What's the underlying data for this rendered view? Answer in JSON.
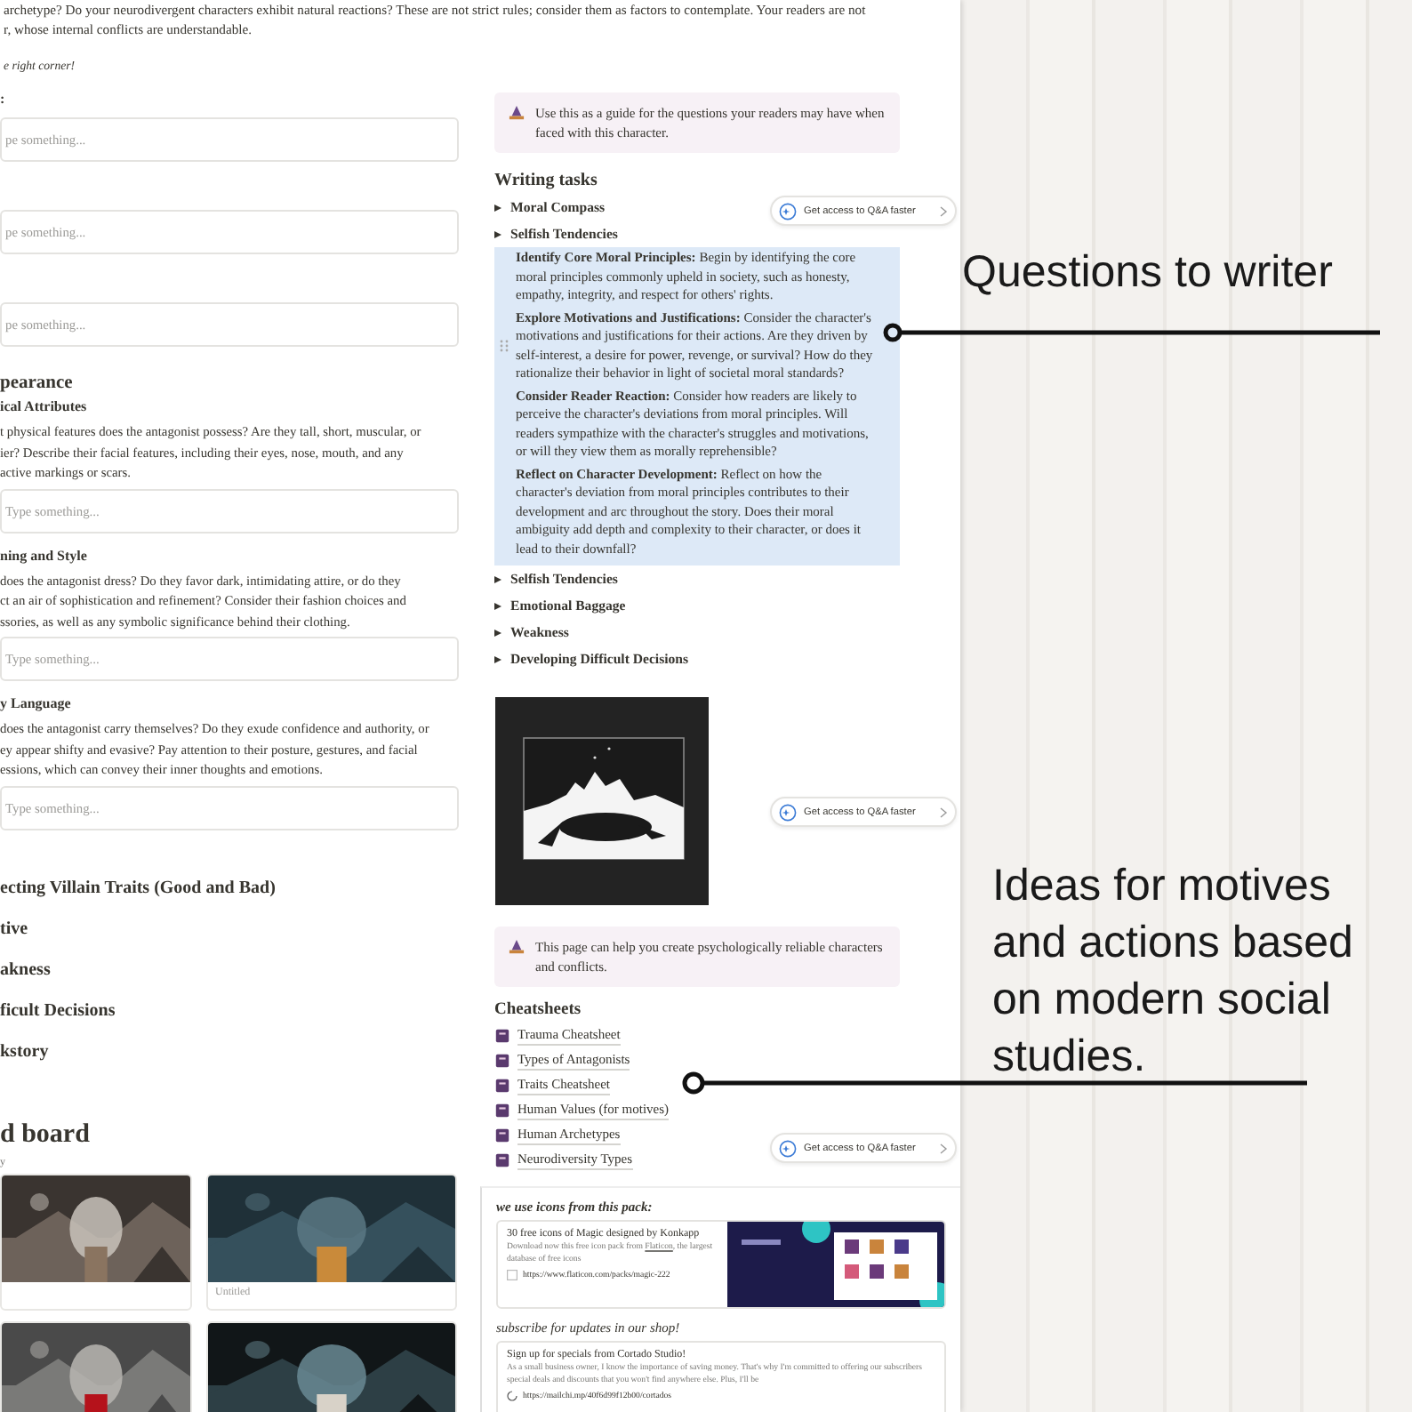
{
  "top_text": {
    "lines": [
      "archetype? Do your neurodivergent characters exhibit natural reactions? These are not strict rules; consider them as factors to contemplate. Your readers are not",
      "r, whose internal conflicts are understandable."
    ],
    "note": "e right corner!"
  },
  "left": {
    "blocks": [
      {
        "kind": "label",
        "text": ":"
      },
      {
        "kind": "field",
        "placeholder": "pe something..."
      },
      {
        "kind": "field",
        "placeholder": "pe something..."
      },
      {
        "kind": "field",
        "placeholder": "pe something..."
      },
      {
        "kind": "heading",
        "text": "pearance"
      },
      {
        "kind": "subheading",
        "text": "ical Attributes"
      },
      {
        "kind": "paragraph",
        "lines": [
          "t physical features does the antagonist possess? Are they tall, short, muscular, or",
          "ier? Describe their facial features, including their eyes, nose, mouth, and any",
          "active markings or scars."
        ]
      },
      {
        "kind": "field",
        "placeholder": "Type something..."
      },
      {
        "kind": "subheading",
        "text": "ning and Style"
      },
      {
        "kind": "paragraph",
        "lines": [
          "does the antagonist dress? Do they favor dark, intimidating attire, or do they",
          "ct an air of sophistication and refinement? Consider their fashion choices and",
          "ssories, as well as any symbolic significance behind their clothing."
        ]
      },
      {
        "kind": "field",
        "placeholder": "Type something..."
      },
      {
        "kind": "subheading",
        "text": "y Language"
      },
      {
        "kind": "paragraph",
        "lines": [
          "does the antagonist carry themselves? Do they exude confidence and authority, or",
          "ey appear shifty and evasive? Pay attention to their posture, gestures, and facial",
          "essions, which can convey their inner thoughts and emotions."
        ]
      },
      {
        "kind": "field",
        "placeholder": "Type something..."
      }
    ],
    "sections": [
      "ecting Villain Traits (Good and Bad)",
      "tive",
      "akness",
      "ficult Decisions",
      "kstory"
    ],
    "board": {
      "title": "d board",
      "subtitle": "y",
      "cards": [
        {
          "kind": "picture"
        },
        {
          "kind": "picture",
          "caption": "Untitled"
        },
        {
          "kind": "picture"
        },
        {
          "kind": "picture"
        }
      ]
    }
  },
  "right": {
    "callout": "Use this as a guide for the questions your readers may have when faced with this character.",
    "writing_tasks": {
      "title": "Writing tasks",
      "toggles_before": [
        "Moral Compass",
        "Selfish Tendencies"
      ],
      "expanded": [
        "**Identify Core Moral Principles:** Begin by identifying the core moral principles commonly upheld in society, such as honesty, empathy, integrity, and respect for others' rights.",
        "**Explore Motivations and Justifications:** Consider the character's motivations and justifications for their actions. Are they driven by self-interest, a desire for power, revenge, or survival? How do they rationalize their behavior in light of societal moral standards?",
        "**Consider Reader Reaction:** Consider how readers are likely to perceive the character's deviations from moral principles. Will readers sympathize with the character's struggles and motivations, or will they view them as morally reprehensible?",
        "**Reflect on Character Development:** Reflect on how the character's deviation from moral principles contributes to their development and arc throughout the story. Does their moral ambiguity add depth and complexity to their character, or does it lead to their downfall?"
      ],
      "toggles_after": [
        "Selfish Tendencies",
        "Emotional Baggage",
        "Weakness",
        "Developing Difficult Decisions"
      ]
    },
    "image": {
      "kind": "picture"
    },
    "callout_2": "This page can help you create psychologically reliable characters and conflicts.",
    "cheatsheets": {
      "title": "Cheatsheets",
      "items": [
        "Trauma Cheatsheet",
        "Types of Antagonists",
        "Traits Cheatsheet",
        "Human Values (for motives)",
        "Human Archetypes",
        "Neurodiversity Types"
      ]
    }
  },
  "pills": [
    "Get access to Q&A faster",
    "Get access to Q&A faster",
    "Get access to Q&A faster"
  ],
  "footer": {
    "icons_heading": "we use icons from this pack:",
    "icons_card": {
      "title": "30 free icons of Magic designed by Konkapp",
      "description_before": "Download now this free icon pack from ",
      "link": "Flaticon",
      "description_after": ", the largest database of free icons",
      "url": "https://www.flaticon.com/packs/magic-222"
    },
    "subscribe_heading": "subscribe for updates in our shop!",
    "subscribe_card": {
      "title": "Sign up for specials from Cortado Studio!",
      "description": "As a small business owner, I know the importance of saving money. That's why I'm committed to offering our subscribers special deals and discounts that you won't find anywhere else. Plus, I'll be",
      "url": "https://mailchi.mp/40f6d99f12b00/cortados"
    }
  },
  "annotations": [
    {
      "lines": [
        "Questions to writer"
      ]
    },
    {
      "lines": [
        "Ideas for motives",
        "and actions based",
        "on modern social",
        "studies."
      ]
    }
  ]
}
